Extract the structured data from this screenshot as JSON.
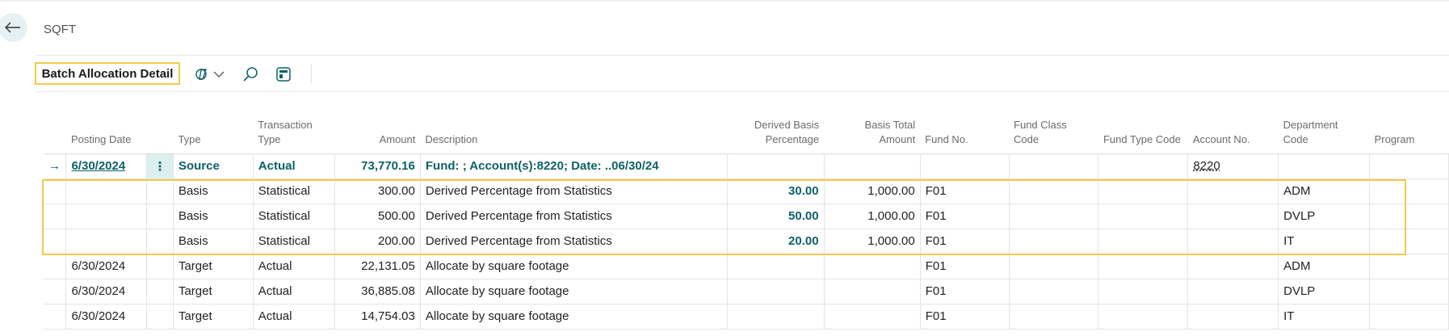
{
  "header": {
    "caption": "SQFT"
  },
  "toolbar": {
    "active_tab": "Batch Allocation Detail",
    "icons": [
      "copilot-icon",
      "chevron-down-icon",
      "search-icon",
      "layout-icon"
    ]
  },
  "colors": {
    "accent": "#0d6267",
    "highlight": "#f3c84b",
    "row_menu_bg": "#dbeef0"
  },
  "table": {
    "columns": [
      {
        "key": "arrow",
        "label": ""
      },
      {
        "key": "posting_date",
        "label": "Posting Date"
      },
      {
        "key": "menu",
        "label": ""
      },
      {
        "key": "type",
        "label": "Type"
      },
      {
        "key": "transaction_type",
        "label": "Transaction Type"
      },
      {
        "key": "amount",
        "label": "Amount"
      },
      {
        "key": "description",
        "label": "Description"
      },
      {
        "key": "derived_basis_pct",
        "label": "Derived Basis Percentage"
      },
      {
        "key": "basis_total",
        "label": "Basis Total Amount"
      },
      {
        "key": "fund_no",
        "label": "Fund No."
      },
      {
        "key": "fund_class",
        "label": "Fund Class Code"
      },
      {
        "key": "fund_type",
        "label": "Fund Type Code"
      },
      {
        "key": "account_no",
        "label": "Account No."
      },
      {
        "key": "department",
        "label": "Department Code"
      },
      {
        "key": "program",
        "label": "Program"
      }
    ],
    "rows": [
      {
        "arrow": "→",
        "posting_date": "6/30/2024",
        "menu": "⋮",
        "type": "Source",
        "transaction_type": "Actual",
        "amount": "73,770.16",
        "description": "Fund: ; Account(s):8220; Date: ..06/30/24",
        "derived_basis_pct": "",
        "basis_total": "",
        "fund_no": "",
        "fund_class": "",
        "fund_type": "",
        "account_no": "8220",
        "department": "",
        "program": ""
      },
      {
        "arrow": "",
        "posting_date": "",
        "menu": "",
        "type": "Basis",
        "transaction_type": "Statistical",
        "amount": "300.00",
        "description": "Derived Percentage from Statistics",
        "derived_basis_pct": "30.00",
        "basis_total": "1,000.00",
        "fund_no": "F01",
        "fund_class": "",
        "fund_type": "",
        "account_no": "",
        "department": "ADM",
        "program": ""
      },
      {
        "arrow": "",
        "posting_date": "",
        "menu": "",
        "type": "Basis",
        "transaction_type": "Statistical",
        "amount": "500.00",
        "description": "Derived Percentage from Statistics",
        "derived_basis_pct": "50.00",
        "basis_total": "1,000.00",
        "fund_no": "F01",
        "fund_class": "",
        "fund_type": "",
        "account_no": "",
        "department": "DVLP",
        "program": ""
      },
      {
        "arrow": "",
        "posting_date": "",
        "menu": "",
        "type": "Basis",
        "transaction_type": "Statistical",
        "amount": "200.00",
        "description": "Derived Percentage from Statistics",
        "derived_basis_pct": "20.00",
        "basis_total": "1,000.00",
        "fund_no": "F01",
        "fund_class": "",
        "fund_type": "",
        "account_no": "",
        "department": "IT",
        "program": ""
      },
      {
        "arrow": "",
        "posting_date": "6/30/2024",
        "menu": "",
        "type": "Target",
        "transaction_type": "Actual",
        "amount": "22,131.05",
        "description": "Allocate by square footage",
        "derived_basis_pct": "",
        "basis_total": "",
        "fund_no": "F01",
        "fund_class": "",
        "fund_type": "",
        "account_no": "",
        "department": "ADM",
        "program": ""
      },
      {
        "arrow": "",
        "posting_date": "6/30/2024",
        "menu": "",
        "type": "Target",
        "transaction_type": "Actual",
        "amount": "36,885.08",
        "description": "Allocate by square footage",
        "derived_basis_pct": "",
        "basis_total": "",
        "fund_no": "F01",
        "fund_class": "",
        "fund_type": "",
        "account_no": "",
        "department": "DVLP",
        "program": ""
      },
      {
        "arrow": "",
        "posting_date": "6/30/2024",
        "menu": "",
        "type": "Target",
        "transaction_type": "Actual",
        "amount": "14,754.03",
        "description": "Allocate by square footage",
        "derived_basis_pct": "",
        "basis_total": "",
        "fund_no": "F01",
        "fund_class": "",
        "fund_type": "",
        "account_no": "",
        "department": "IT",
        "program": ""
      }
    ]
  }
}
